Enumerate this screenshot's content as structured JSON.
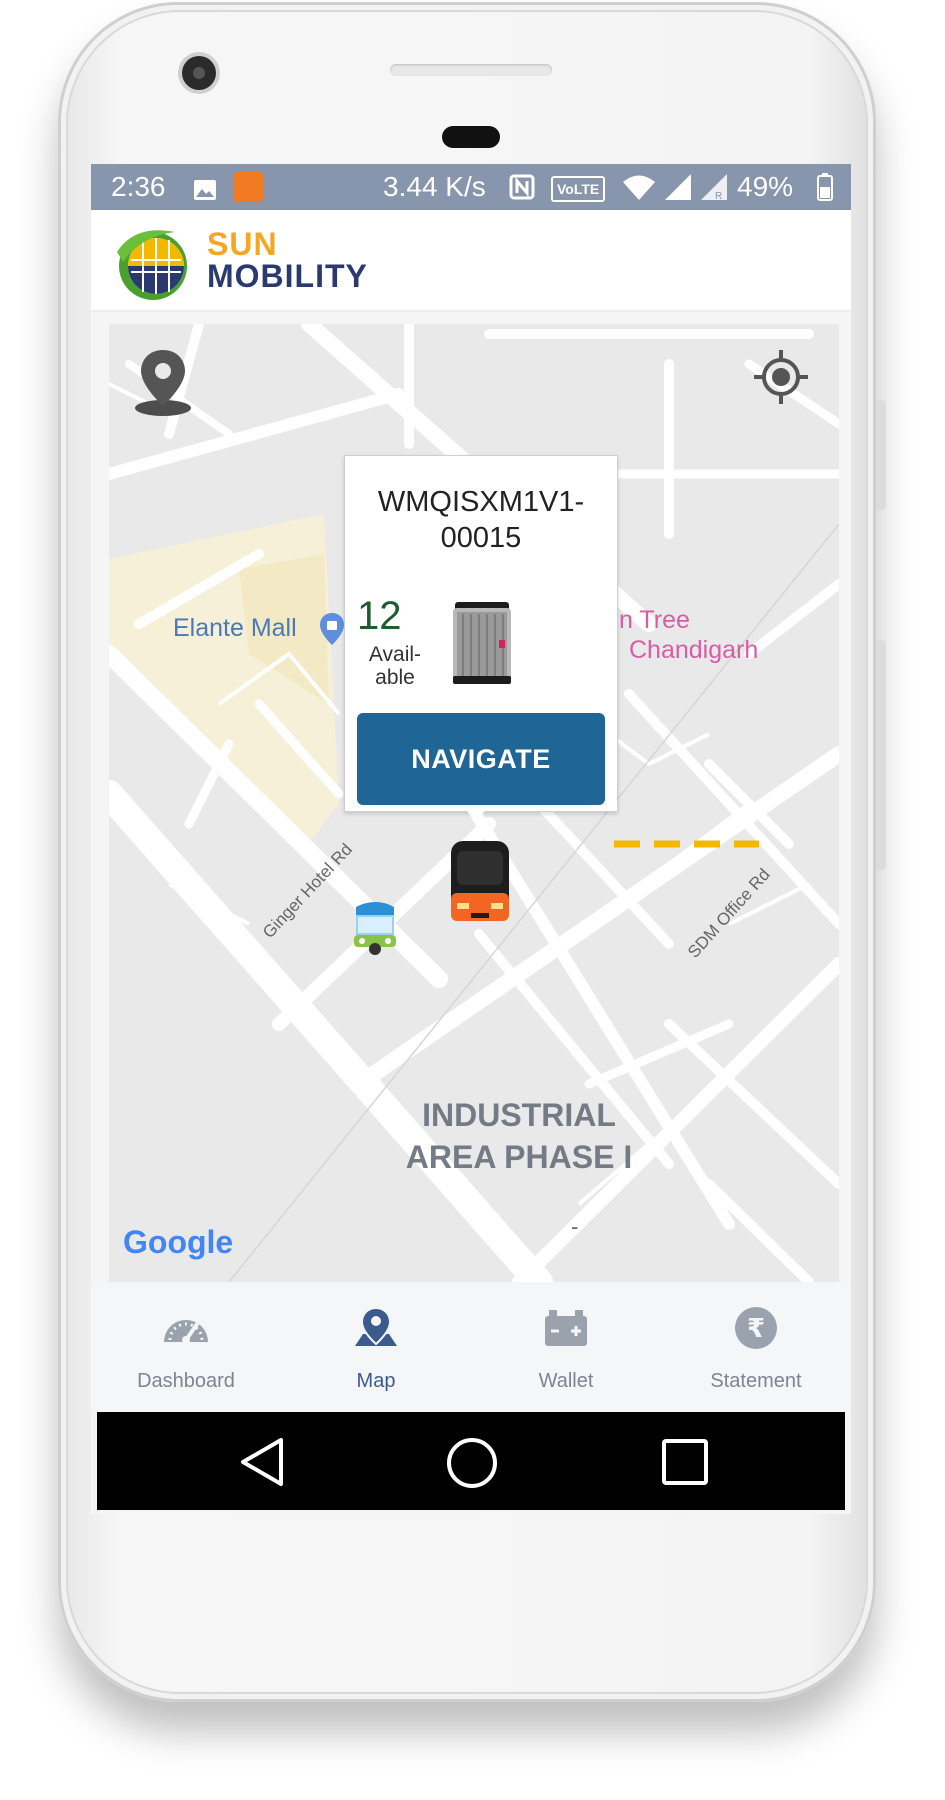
{
  "status_bar": {
    "time": "2:36",
    "speed": "3.44 K/s",
    "volte": "VoLTE",
    "battery": "49%"
  },
  "brand": {
    "line1": "SUN",
    "line2": "MOBILITY"
  },
  "map": {
    "places": {
      "mall": "Elante Mall",
      "partial_tree": "n Tree",
      "partial_city": "Chandigarh"
    },
    "roads": {
      "ginger": "Ginger Hotel Rd",
      "sdm": "SDM Office Rd"
    },
    "area": {
      "line1": "INDUSTRIAL",
      "line2": "AREA PHASE I"
    },
    "minor_mark": "-",
    "attribution": "Google"
  },
  "station_popup": {
    "station_id": "WMQISXM1V1-00015",
    "available_count": "12",
    "available_label_1": "Avail-",
    "available_label_2": "able",
    "navigate_label": "NAVIGATE"
  },
  "bottom_nav": [
    {
      "label": "Dashboard",
      "icon": "speedometer-icon",
      "active": false
    },
    {
      "label": "Map",
      "icon": "map-pin-icon",
      "active": true
    },
    {
      "label": "Wallet",
      "icon": "battery-icon",
      "active": false
    },
    {
      "label": "Statement",
      "icon": "rupee-icon",
      "active": false
    }
  ],
  "colors": {
    "status_bar_bg": "#8795ad",
    "accent_blue": "#1f6697",
    "nav_active": "#3d5a8c",
    "brand_orange": "#f5a623",
    "brand_navy": "#2a3a6e",
    "map_yellow_dash": "#f5b800"
  }
}
